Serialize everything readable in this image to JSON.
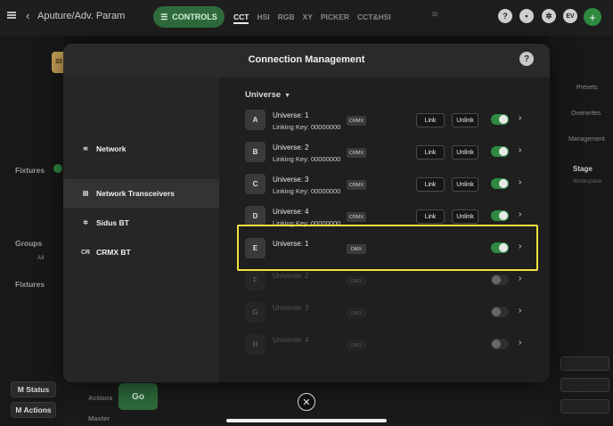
{
  "app": {
    "breadcrumb": "Aputure/Adv. Param",
    "controls_label": "CONTROLS",
    "mode_tabs": [
      "CCT",
      "HSI",
      "RGB",
      "XY",
      "PICKER",
      "CCT&HSI"
    ],
    "profile_initials": "EV"
  },
  "background": {
    "yellow_chip": "33",
    "fixtures_label": "Fixtures",
    "groups_label": "Groups",
    "groups_all": "All",
    "fixtures_label_2": "Fixtures",
    "m_status": "M Status",
    "m_actions": "M Actions",
    "actions_label": "Actions",
    "go_label": "Go",
    "master_label": "Master",
    "right_items": [
      "Presets",
      "Overwrites",
      "Management"
    ],
    "stage_label": "Stage",
    "stage_sub": "Workspace"
  },
  "modal": {
    "title": "Connection Management",
    "help": "?",
    "sidebar": [
      {
        "icon": "wifi-icon",
        "glyph": "≋",
        "label": "Network"
      },
      {
        "icon": "transceiver-icon",
        "glyph": "▤",
        "label": "Network Transceivers"
      },
      {
        "icon": "sidus-bt-icon",
        "glyph": "✲",
        "label": "Sidus BT"
      },
      {
        "icon": "crmx-icon",
        "glyph": "CR",
        "label": "CRMX BT"
      }
    ],
    "universe_header": "Universe",
    "rows": [
      {
        "letter": "A",
        "name": "Universe: 1",
        "key": "Linking Key: 00000000",
        "type": "CRMX",
        "link": "Link",
        "unlink": "Unlink",
        "on": true
      },
      {
        "letter": "B",
        "name": "Universe: 2",
        "key": "Linking Key: 00000000",
        "type": "CRMX",
        "link": "Link",
        "unlink": "Unlink",
        "on": true
      },
      {
        "letter": "C",
        "name": "Universe: 3",
        "key": "Linking Key: 00000000",
        "type": "CRMX",
        "link": "Link",
        "unlink": "Unlink",
        "on": true
      },
      {
        "letter": "D",
        "name": "Universe: 4",
        "key": "Linking Key: 00000000",
        "type": "CRMX",
        "link": "Link",
        "unlink": "Unlink",
        "on": true
      },
      {
        "letter": "E",
        "name": "Universe: 1",
        "type": "DMX",
        "on": true
      },
      {
        "letter": "F",
        "name": "Universe: 2",
        "type": "DMX",
        "on": false
      },
      {
        "letter": "G",
        "name": "Universe: 3",
        "type": "DMX",
        "on": false
      },
      {
        "letter": "H",
        "name": "Universe: 4",
        "type": "DMX",
        "on": false
      }
    ],
    "close": "✕"
  },
  "colors": {
    "accent_green": "#2f8a40",
    "highlight_yellow": "#f4e23c"
  }
}
